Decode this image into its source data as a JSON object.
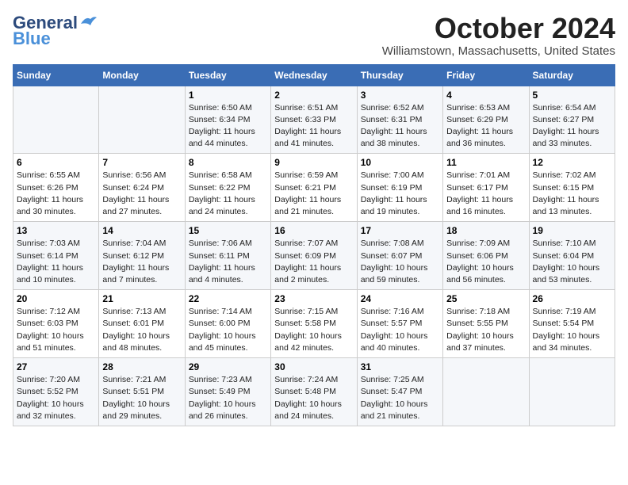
{
  "logo": {
    "line1": "General",
    "line2": "Blue"
  },
  "title": "October 2024",
  "location": "Williamstown, Massachusetts, United States",
  "days_of_week": [
    "Sunday",
    "Monday",
    "Tuesday",
    "Wednesday",
    "Thursday",
    "Friday",
    "Saturday"
  ],
  "weeks": [
    [
      {
        "num": "",
        "info": ""
      },
      {
        "num": "",
        "info": ""
      },
      {
        "num": "1",
        "info": "Sunrise: 6:50 AM\nSunset: 6:34 PM\nDaylight: 11 hours and 44 minutes."
      },
      {
        "num": "2",
        "info": "Sunrise: 6:51 AM\nSunset: 6:33 PM\nDaylight: 11 hours and 41 minutes."
      },
      {
        "num": "3",
        "info": "Sunrise: 6:52 AM\nSunset: 6:31 PM\nDaylight: 11 hours and 38 minutes."
      },
      {
        "num": "4",
        "info": "Sunrise: 6:53 AM\nSunset: 6:29 PM\nDaylight: 11 hours and 36 minutes."
      },
      {
        "num": "5",
        "info": "Sunrise: 6:54 AM\nSunset: 6:27 PM\nDaylight: 11 hours and 33 minutes."
      }
    ],
    [
      {
        "num": "6",
        "info": "Sunrise: 6:55 AM\nSunset: 6:26 PM\nDaylight: 11 hours and 30 minutes."
      },
      {
        "num": "7",
        "info": "Sunrise: 6:56 AM\nSunset: 6:24 PM\nDaylight: 11 hours and 27 minutes."
      },
      {
        "num": "8",
        "info": "Sunrise: 6:58 AM\nSunset: 6:22 PM\nDaylight: 11 hours and 24 minutes."
      },
      {
        "num": "9",
        "info": "Sunrise: 6:59 AM\nSunset: 6:21 PM\nDaylight: 11 hours and 21 minutes."
      },
      {
        "num": "10",
        "info": "Sunrise: 7:00 AM\nSunset: 6:19 PM\nDaylight: 11 hours and 19 minutes."
      },
      {
        "num": "11",
        "info": "Sunrise: 7:01 AM\nSunset: 6:17 PM\nDaylight: 11 hours and 16 minutes."
      },
      {
        "num": "12",
        "info": "Sunrise: 7:02 AM\nSunset: 6:15 PM\nDaylight: 11 hours and 13 minutes."
      }
    ],
    [
      {
        "num": "13",
        "info": "Sunrise: 7:03 AM\nSunset: 6:14 PM\nDaylight: 11 hours and 10 minutes."
      },
      {
        "num": "14",
        "info": "Sunrise: 7:04 AM\nSunset: 6:12 PM\nDaylight: 11 hours and 7 minutes."
      },
      {
        "num": "15",
        "info": "Sunrise: 7:06 AM\nSunset: 6:11 PM\nDaylight: 11 hours and 4 minutes."
      },
      {
        "num": "16",
        "info": "Sunrise: 7:07 AM\nSunset: 6:09 PM\nDaylight: 11 hours and 2 minutes."
      },
      {
        "num": "17",
        "info": "Sunrise: 7:08 AM\nSunset: 6:07 PM\nDaylight: 10 hours and 59 minutes."
      },
      {
        "num": "18",
        "info": "Sunrise: 7:09 AM\nSunset: 6:06 PM\nDaylight: 10 hours and 56 minutes."
      },
      {
        "num": "19",
        "info": "Sunrise: 7:10 AM\nSunset: 6:04 PM\nDaylight: 10 hours and 53 minutes."
      }
    ],
    [
      {
        "num": "20",
        "info": "Sunrise: 7:12 AM\nSunset: 6:03 PM\nDaylight: 10 hours and 51 minutes."
      },
      {
        "num": "21",
        "info": "Sunrise: 7:13 AM\nSunset: 6:01 PM\nDaylight: 10 hours and 48 minutes."
      },
      {
        "num": "22",
        "info": "Sunrise: 7:14 AM\nSunset: 6:00 PM\nDaylight: 10 hours and 45 minutes."
      },
      {
        "num": "23",
        "info": "Sunrise: 7:15 AM\nSunset: 5:58 PM\nDaylight: 10 hours and 42 minutes."
      },
      {
        "num": "24",
        "info": "Sunrise: 7:16 AM\nSunset: 5:57 PM\nDaylight: 10 hours and 40 minutes."
      },
      {
        "num": "25",
        "info": "Sunrise: 7:18 AM\nSunset: 5:55 PM\nDaylight: 10 hours and 37 minutes."
      },
      {
        "num": "26",
        "info": "Sunrise: 7:19 AM\nSunset: 5:54 PM\nDaylight: 10 hours and 34 minutes."
      }
    ],
    [
      {
        "num": "27",
        "info": "Sunrise: 7:20 AM\nSunset: 5:52 PM\nDaylight: 10 hours and 32 minutes."
      },
      {
        "num": "28",
        "info": "Sunrise: 7:21 AM\nSunset: 5:51 PM\nDaylight: 10 hours and 29 minutes."
      },
      {
        "num": "29",
        "info": "Sunrise: 7:23 AM\nSunset: 5:49 PM\nDaylight: 10 hours and 26 minutes."
      },
      {
        "num": "30",
        "info": "Sunrise: 7:24 AM\nSunset: 5:48 PM\nDaylight: 10 hours and 24 minutes."
      },
      {
        "num": "31",
        "info": "Sunrise: 7:25 AM\nSunset: 5:47 PM\nDaylight: 10 hours and 21 minutes."
      },
      {
        "num": "",
        "info": ""
      },
      {
        "num": "",
        "info": ""
      }
    ]
  ]
}
